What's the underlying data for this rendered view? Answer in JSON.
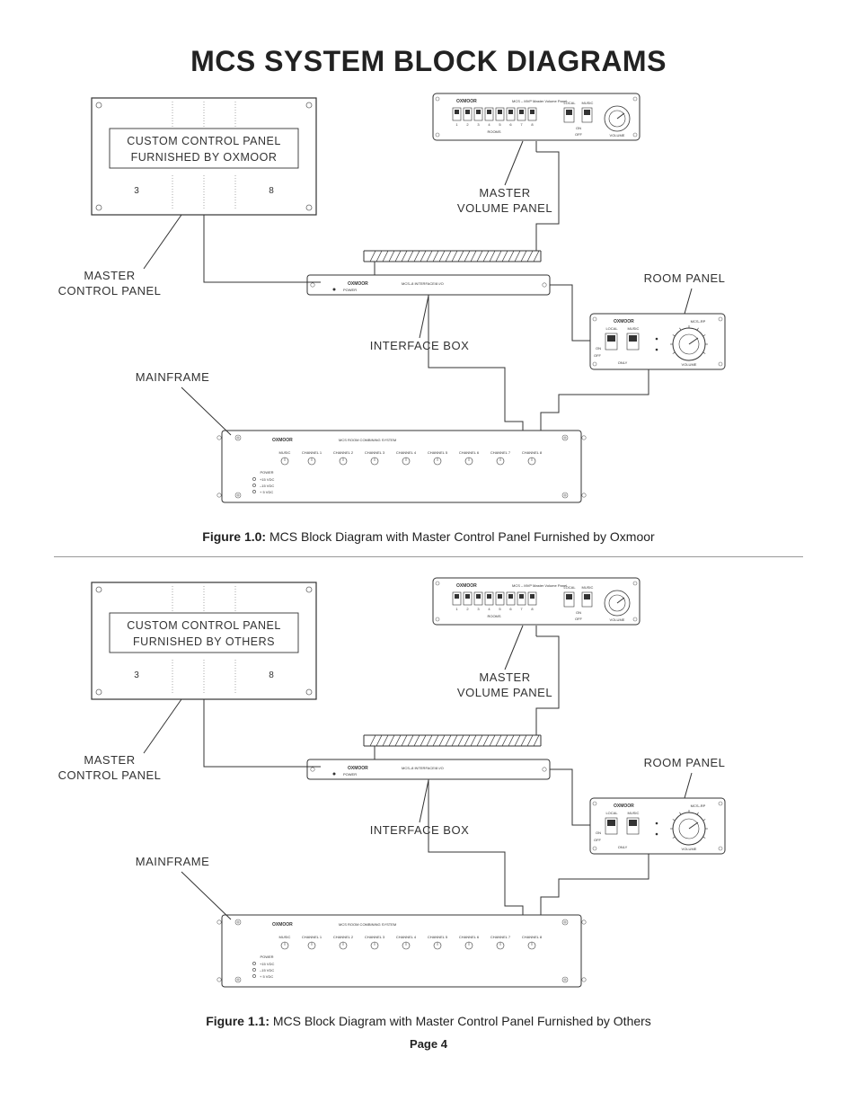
{
  "title": "MCS SYSTEM BLOCK DIAGRAMS",
  "footer": "Page  4",
  "diagrams": [
    {
      "captionBold": "Figure 1.0:",
      "captionRest": " MCS Block Diagram with Master Control Panel Furnished by Oxmoor",
      "customPanel": {
        "line1": "CUSTOM CONTROL PANEL",
        "line2": "FURNISHED BY OXMOOR",
        "left": "3",
        "right": "8"
      },
      "labels": {
        "masterVolume1": "MASTER",
        "masterVolume2": "VOLUME PANEL",
        "roomPanel": "ROOM PANEL",
        "masterCtrl1": "MASTER",
        "masterCtrl2": "CONTROL PANEL",
        "interface": "INTERFACE BOX",
        "mainframe": "MAINFRAME"
      },
      "brand": "OXMOOR",
      "mvpSub": "MCS – MVP Master Volume Panel",
      "local": "LOCAL",
      "music": "MUSIC",
      "on": "ON",
      "off": "OFF",
      "volume": "VOLUME",
      "rooms": "ROOMS",
      "roomNums": [
        "1",
        "2",
        "3",
        "4",
        "5",
        "6",
        "7",
        "8"
      ],
      "ifBoxSub": "MCS–8 INTERFACE/8 I/O",
      "power": "POWER",
      "mfSub": "MCS ROOM COMBINING SYSTEM",
      "mfMusic": "MUSIC",
      "mfChannels": [
        "CHANNEL 1",
        "CHANNEL 2",
        "CHANNEL 3",
        "CHANNEL 4",
        "CHANNEL 5",
        "CHANNEL 6",
        "CHANNEL 7",
        "CHANNEL 8"
      ],
      "mfPower": "POWER",
      "mfV1": "+15 VDC",
      "mfV2": "–15 VDC",
      "mfV3": "+ 5 VDC",
      "rpSub": "MCS–RP",
      "rpOnly": "ONLY"
    },
    {
      "captionBold": "Figure 1.1:",
      "captionRest": " MCS Block Diagram with Master Control Panel Furnished by Others",
      "customPanel": {
        "line1": "CUSTOM CONTROL PANEL",
        "line2": "FURNISHED BY OTHERS",
        "left": "3",
        "right": "8"
      },
      "labels": {
        "masterVolume1": "MASTER",
        "masterVolume2": "VOLUME PANEL",
        "roomPanel": "ROOM PANEL",
        "masterCtrl1": "MASTER",
        "masterCtrl2": "CONTROL PANEL",
        "interface": "INTERFACE BOX",
        "mainframe": "MAINFRAME"
      },
      "brand": "OXMOOR",
      "mvpSub": "MCS – MVP Master Volume Panel",
      "local": "LOCAL",
      "music": "MUSIC",
      "on": "ON",
      "off": "OFF",
      "volume": "VOLUME",
      "rooms": "ROOMS",
      "roomNums": [
        "1",
        "2",
        "3",
        "4",
        "5",
        "6",
        "7",
        "8"
      ],
      "ifBoxSub": "MCS–8 INTERFACE/8 I/O",
      "power": "POWER",
      "mfSub": "MCS ROOM COMBINING SYSTEM",
      "mfMusic": "MUSIC",
      "mfChannels": [
        "CHANNEL 1",
        "CHANNEL 2",
        "CHANNEL 3",
        "CHANNEL 4",
        "CHANNEL 5",
        "CHANNEL 6",
        "CHANNEL 7",
        "CHANNEL 8"
      ],
      "mfPower": "POWER",
      "mfV1": "+15 VDC",
      "mfV2": "–15 VDC",
      "mfV3": "+ 5 VDC",
      "rpSub": "MCS–RP",
      "rpOnly": "ONLY"
    }
  ]
}
